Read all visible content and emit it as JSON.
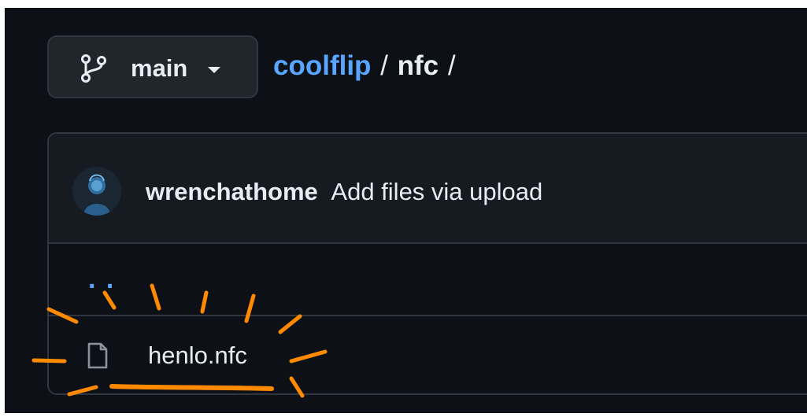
{
  "branch": {
    "name": "main",
    "icon": "git-branch-icon"
  },
  "breadcrumb": {
    "owner": "coolflip",
    "separator": "/",
    "folder": "nfc",
    "trailing_separator": "/"
  },
  "commit": {
    "author": "wrenchathome",
    "message": "Add files via upload",
    "avatar_icon": "user-avatar"
  },
  "parent": {
    "label": ". ."
  },
  "files": [
    {
      "name": "henlo.nfc",
      "icon": "file-icon"
    }
  ],
  "colors": {
    "background": "#0d1117",
    "link": "#58a6ff",
    "text": "#e6edf3",
    "border": "#30363d",
    "annotation": "#ff8a00"
  }
}
